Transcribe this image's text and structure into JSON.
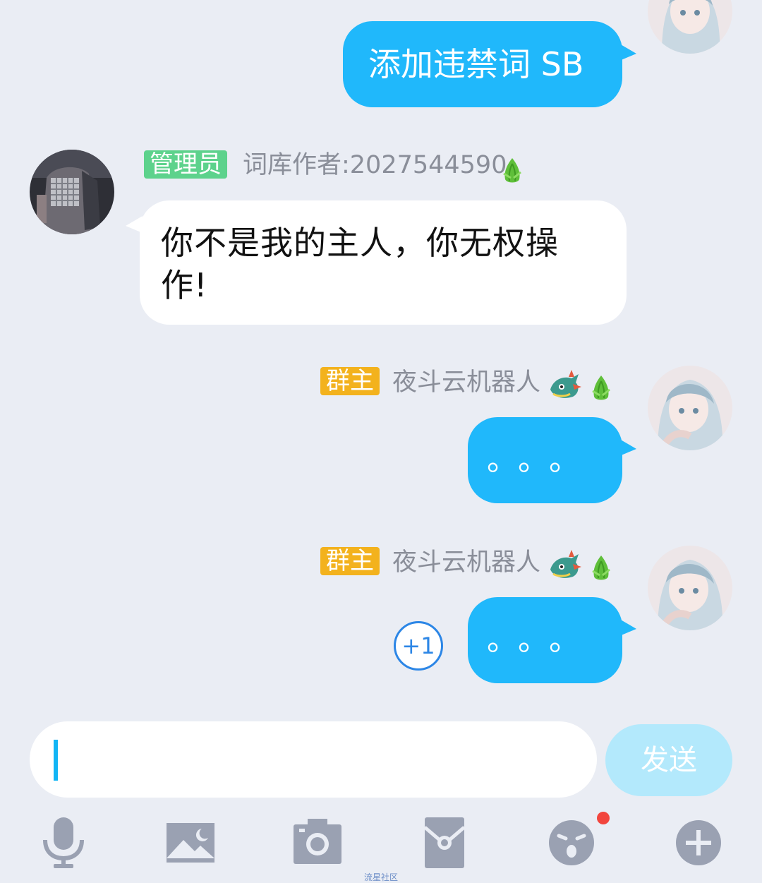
{
  "messages": [
    {
      "side": "right",
      "text": "添加违禁词 SB"
    },
    {
      "side": "left",
      "badge": "管理员",
      "sender": "词库作者:2027544590",
      "text_line1": "你不是我的主人，你无权操",
      "text_line2": "作!"
    },
    {
      "side": "right",
      "badge": "群主",
      "sender": "夜斗云机器人",
      "text": "。。。"
    },
    {
      "side": "right",
      "badge": "群主",
      "sender": "夜斗云机器人",
      "text": "。。。",
      "plus_one": "+1"
    }
  ],
  "input": {
    "value": "",
    "send_label": "发送"
  },
  "toolbar": {
    "items": [
      "microphone-icon",
      "image-icon",
      "camera-icon",
      "red-packet-icon",
      "emoji-icon",
      "plus-icon"
    ],
    "emoji_has_notification": true
  },
  "watermark": "流星社区",
  "colors": {
    "background": "#EAEDF4",
    "bubble_blue": "#20B8FB",
    "admin_badge": "#5DD28C",
    "owner_badge": "#F3B21D",
    "send_button": "#B3E9FC",
    "toolbar_icon": "#9AA1B2"
  }
}
